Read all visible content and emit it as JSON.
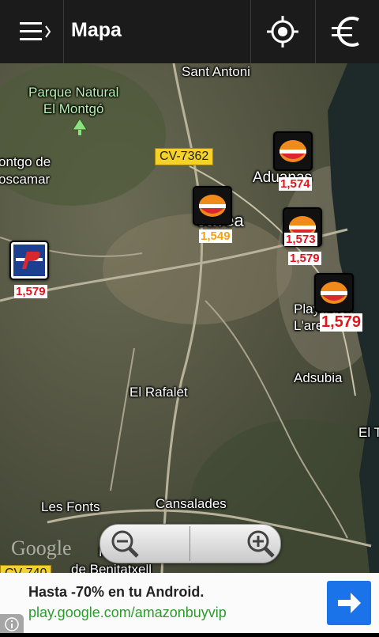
{
  "topbar": {
    "title": "Mapa",
    "menu_icon": "menu-icon",
    "locate_icon": "crosshair-icon",
    "currency_icon": "euro-icon"
  },
  "map": {
    "labels": {
      "sant_antoni": "Sant Antoni",
      "park": "Parque Natural\nEl Montgó",
      "montgo": "ontgo de\noscamar",
      "aduanas": "Aduanas",
      "javea": "Jávea",
      "playa": "Playa de\nL'arenal",
      "adsubia": "Adsubia",
      "rafalet": "El Rafalet",
      "el_t": "El T",
      "les_fonts": "Les Fonts",
      "cansalades": "Cansalades",
      "benitatxell": "de Benitatxell",
      "p_label": "P"
    },
    "road_signs": {
      "cv7362": "CV-7362",
      "cv740": "CV-740"
    },
    "stations": [
      {
        "brand": "repsol",
        "price": "1,574"
      },
      {
        "brand": "repsol",
        "price": "1,549"
      },
      {
        "brand": "repsol",
        "price": "1,573"
      },
      {
        "brand": "repsol",
        "price": "1,579"
      },
      {
        "brand": "petronor",
        "price": "1,579"
      },
      {
        "brand": "repsol",
        "price": "1,579"
      }
    ],
    "google_logo": "Google",
    "zoom": {
      "out_icon": "zoom-out-icon",
      "in_icon": "zoom-in-icon"
    }
  },
  "ad": {
    "title": "Hasta -70% en tu Android.",
    "url": "play.google.com/amazonbuyvip",
    "button_icon": "arrow-right-icon",
    "info_icon": "info-icon"
  }
}
